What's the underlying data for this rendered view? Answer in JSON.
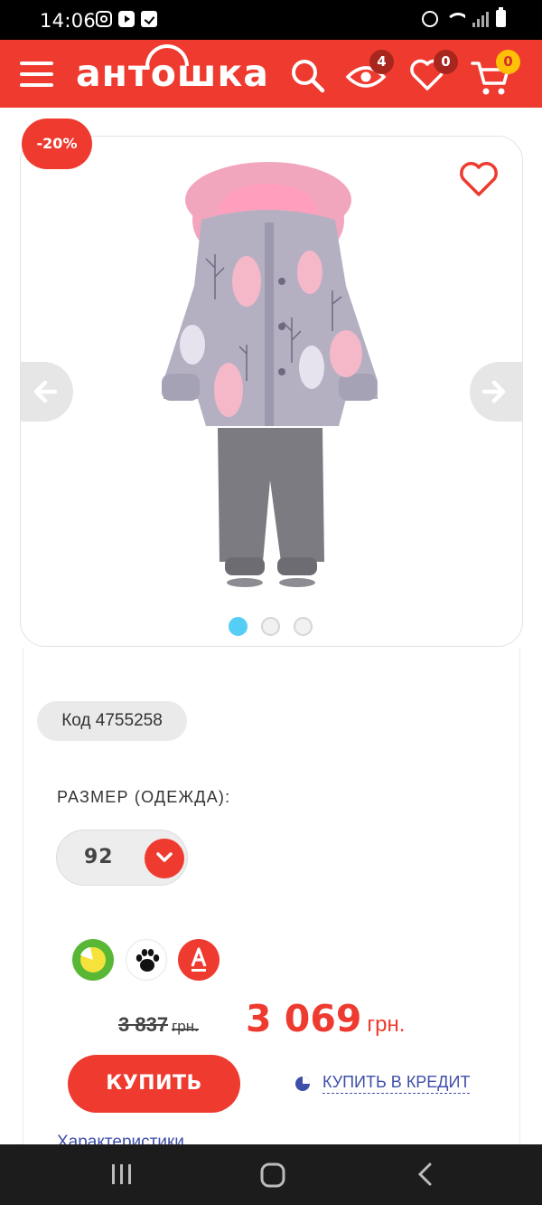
{
  "status_bar": {
    "time": "14:06",
    "icons": [
      "instagram-icon",
      "youtube-icon",
      "check-icon",
      "alarm-icon",
      "wifi-icon",
      "signal-icon",
      "battery-icon"
    ]
  },
  "header": {
    "logo": "антошка",
    "badges": {
      "viewed": "4",
      "favorites": "0",
      "cart": "0"
    },
    "colors": {
      "header": "#ee3a2f",
      "badge_dark": "#a8261e",
      "badge_cart": "#ffc107"
    }
  },
  "product": {
    "discount": "-20%",
    "gallery_active_index": 0,
    "gallery_count": 3,
    "code": "Код 4755258",
    "size_label": "РАЗМЕР (ОДЕЖДА):",
    "size_value": "92",
    "payment_icons": [
      "pie-icon",
      "paw-icon",
      "alfa-icon"
    ],
    "old_price": "3 837",
    "old_currency": "грн.",
    "new_price": "3 069",
    "new_currency": "грн.",
    "buy_label": "КУПИТЬ",
    "credit_label": "КУПИТЬ В КРЕДИТ",
    "characteristics_label": "Характеристики"
  },
  "colors": {
    "accent": "#ee3a2f",
    "link": "#3f4fa8",
    "dot_active": "#56cdf5"
  }
}
